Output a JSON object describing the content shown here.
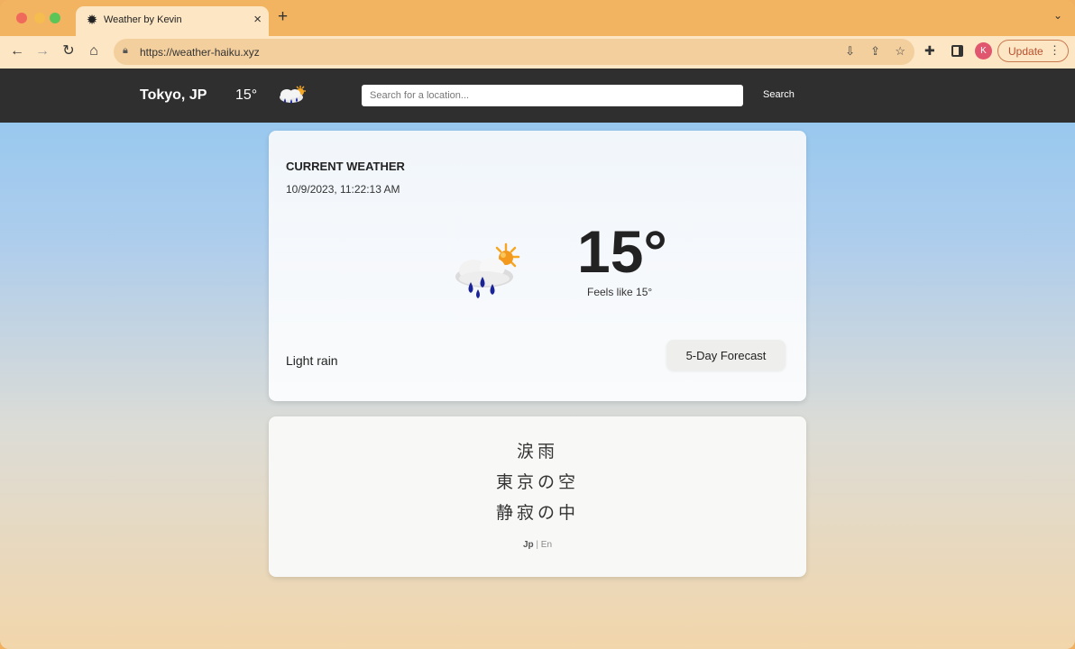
{
  "browser": {
    "tab_title": "Weather by Kevin",
    "url": "https://weather-haiku.xyz",
    "profile_initial": "K",
    "update_label": "Update"
  },
  "appbar": {
    "city": "Tokyo, JP",
    "temp": "15°",
    "weather_icon": "light-rain-sun-icon",
    "search_placeholder": "Search for a location...",
    "search_button": "Search"
  },
  "current_weather": {
    "title": "CURRENT WEATHER",
    "datetime": "10/9/2023, 11:22:13 AM",
    "temp": "15°",
    "feels_like": "Feels like 15°",
    "description": "Light rain",
    "forecast_button": "5-Day Forecast",
    "icon": "light-rain-sun-icon"
  },
  "haiku": {
    "lines": [
      "涙雨",
      "東京の空",
      "静寂の中"
    ],
    "lang_jp": "Jp",
    "lang_separator": "|",
    "lang_en": "En"
  },
  "colors": {
    "appbar": "#2f2f2f",
    "tabstrip": "#f2b461",
    "toolbar": "#fde6c4",
    "raindrop": "#1f2a9e",
    "sun": "#f5a623"
  }
}
